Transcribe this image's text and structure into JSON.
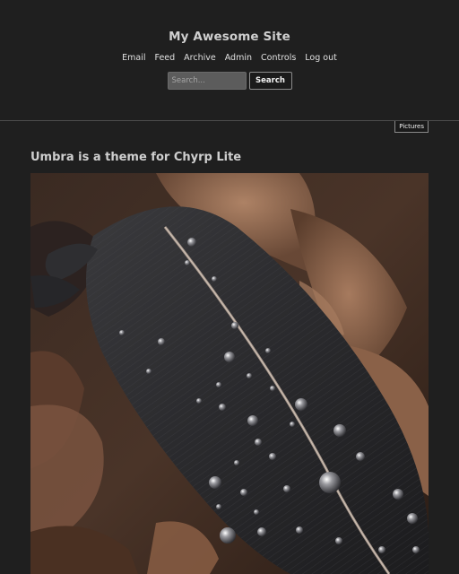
{
  "site": {
    "title": "My Awesome Site"
  },
  "nav": {
    "items": [
      {
        "label": "Email"
      },
      {
        "label": "Feed"
      },
      {
        "label": "Archive"
      },
      {
        "label": "Admin"
      },
      {
        "label": "Controls"
      },
      {
        "label": "Log out"
      }
    ]
  },
  "search": {
    "placeholder": "Search...",
    "value": "",
    "button_label": "Search"
  },
  "post": {
    "category": "Pictures",
    "title": "Umbra is a theme for Chyrp Lite",
    "image_subject": "black-feather-with-water-droplets-on-brown-leaves"
  },
  "colors": {
    "background": "#1f1f1f",
    "title_text": "#cfcfcf",
    "divider": "#4d4d4d",
    "search_field": "#5c5c5c"
  }
}
